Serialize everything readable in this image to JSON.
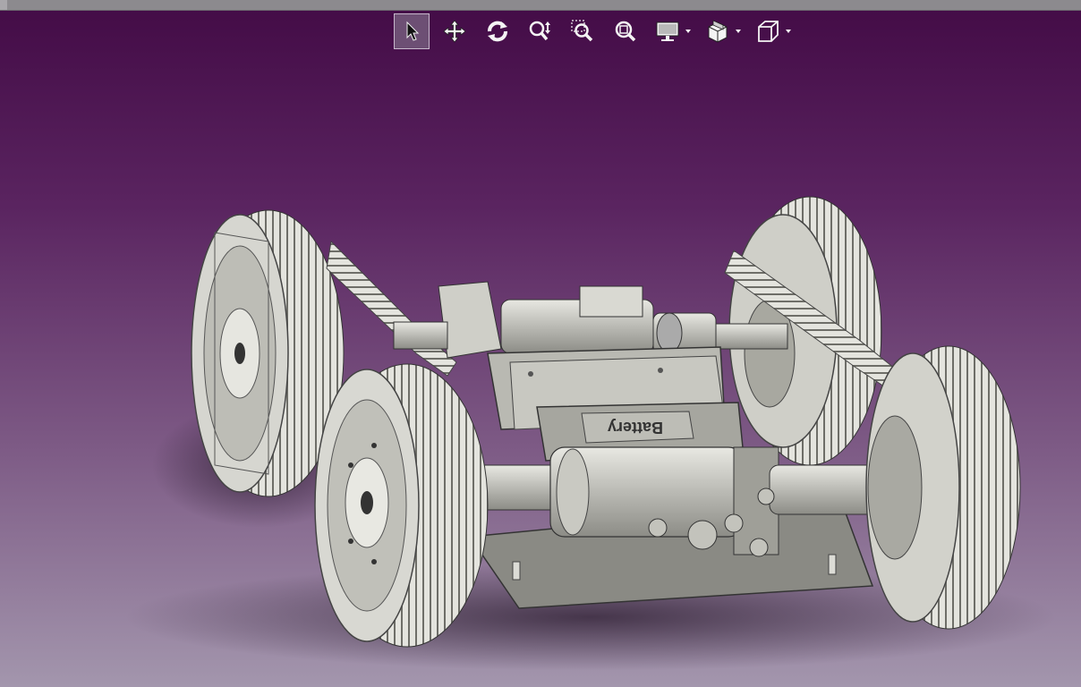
{
  "window": {
    "background_top": "#430b46",
    "background_bottom": "#a396ad"
  },
  "toolbar": {
    "tools": [
      {
        "id": "select",
        "icon": "pointer-arrow-icon",
        "active": true
      },
      {
        "id": "pan",
        "icon": "move-arrows-icon",
        "active": false
      },
      {
        "id": "rotate",
        "icon": "rotate-icon",
        "active": false
      },
      {
        "id": "zoom",
        "icon": "zoom-updown-icon",
        "active": false
      },
      {
        "id": "zoom-area",
        "icon": "zoom-area-icon",
        "active": false
      },
      {
        "id": "zoom-fit",
        "icon": "zoom-fit-icon",
        "active": false
      },
      {
        "id": "display-mode",
        "icon": "monitor-icon",
        "dropdown": true
      },
      {
        "id": "section-view",
        "icon": "section-cube-icon",
        "dropdown": true
      },
      {
        "id": "view-orientation",
        "icon": "wireframe-cube-icon",
        "dropdown": true
      }
    ]
  },
  "model": {
    "battery_label": "Battery",
    "accent_metal": "#d8d8d2",
    "shadow": "#3a2a40"
  }
}
